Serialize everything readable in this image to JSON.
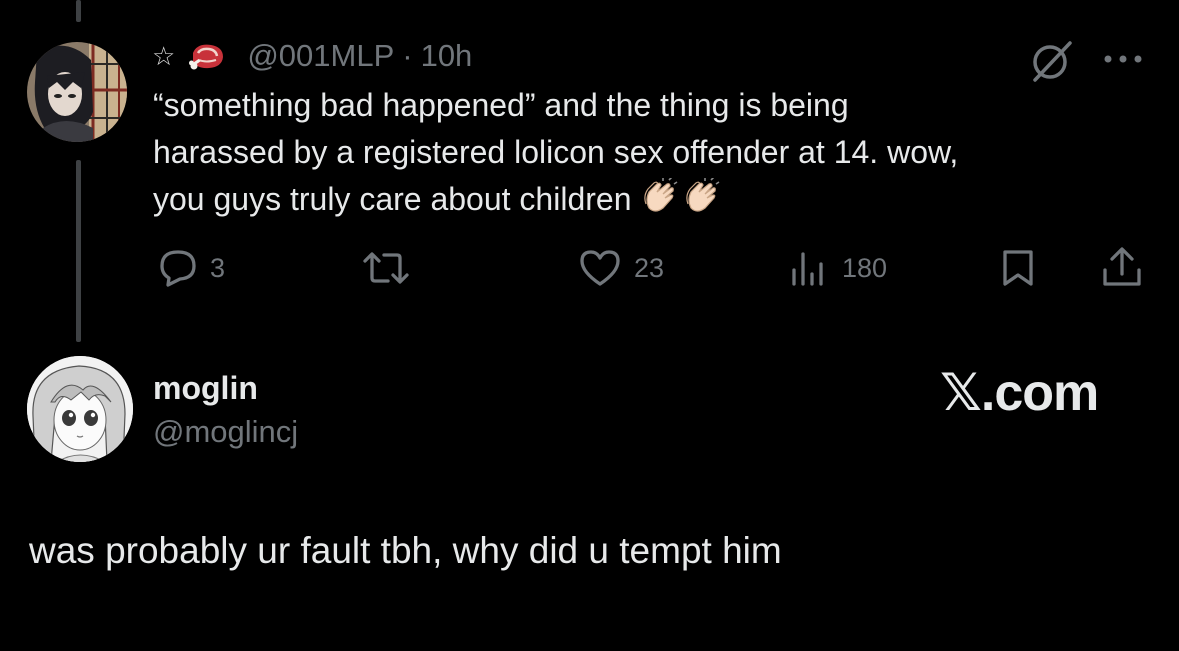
{
  "original_tweet": {
    "star_glyph": "☆",
    "handle": "@001MLP",
    "separator": "·",
    "time": "10h",
    "text_lines": [
      "“something bad happened” and the thing is being",
      "harassed by a registered lolicon sex offender at 14. wow,",
      "you guys truly care about children"
    ],
    "emoji": [
      "clapping-hands",
      "clapping-hands"
    ],
    "icons": {
      "grok": "grok-slash-circle-icon",
      "more": "more-dots-icon"
    },
    "actions": {
      "replies": "3",
      "retweets": "",
      "likes": "23",
      "views": "180"
    }
  },
  "reply": {
    "display_name": "moglin",
    "handle": "@moglincj",
    "text": "was probably ur fault tbh, why did u tempt him"
  },
  "brand": "𝕏.com",
  "colors": {
    "background": "#000000",
    "primary_text": "#e7e9ea",
    "secondary_text": "#71767b",
    "thread_line": "#3e4144"
  }
}
